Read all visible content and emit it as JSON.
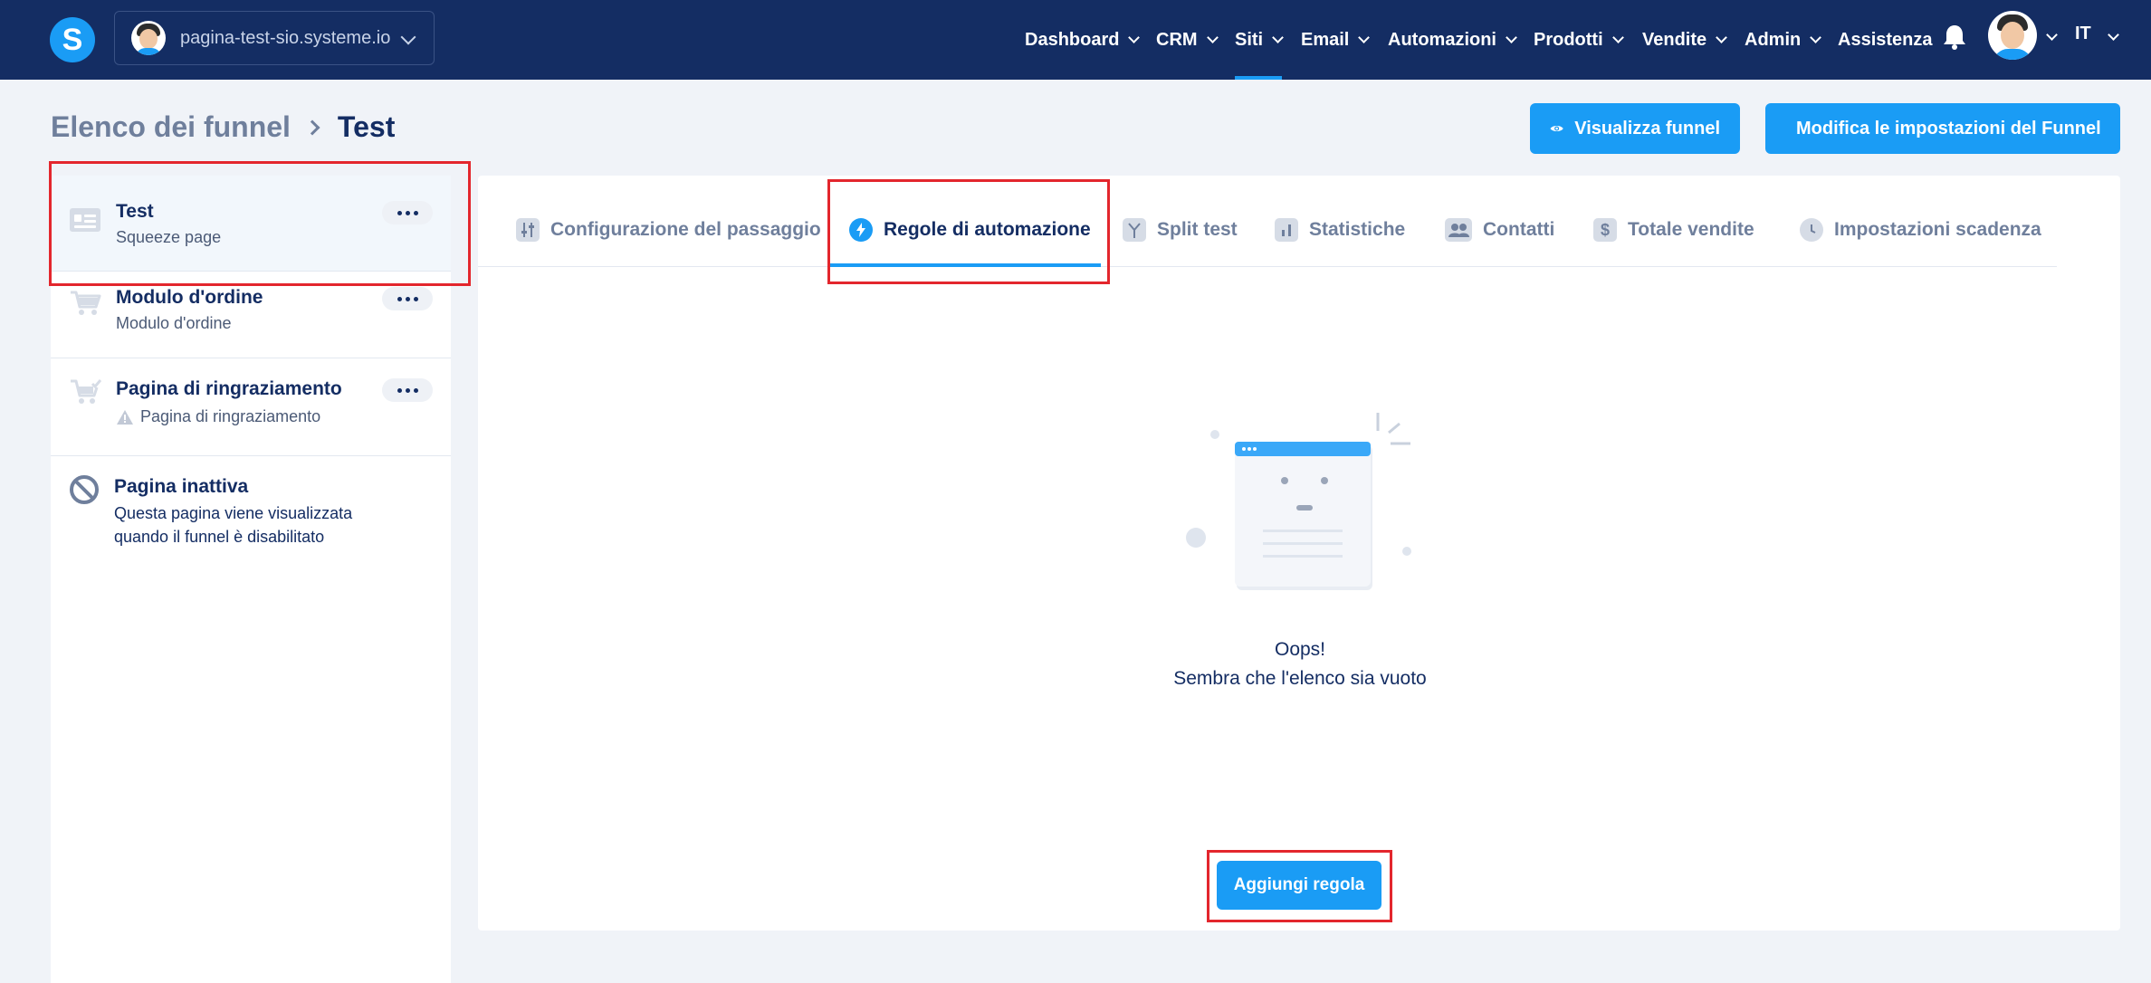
{
  "topbar": {
    "site_name": "pagina-test-sio.systeme.io",
    "nav": [
      "Dashboard",
      "CRM",
      "Siti",
      "Email",
      "Automazioni",
      "Prodotti",
      "Vendite",
      "Admin",
      "Assistenza"
    ],
    "active_nav": "Siti",
    "language": "IT"
  },
  "header": {
    "breadcrumb_parent": "Elenco dei funnel",
    "breadcrumb_current": "Test",
    "view_funnel_label": "Visualizza funnel",
    "settings_label": "Modifica le impostazioni del Funnel"
  },
  "steps": [
    {
      "title": "Test",
      "subtitle": "Squeeze page"
    },
    {
      "title": "Modulo d'ordine",
      "subtitle": "Modulo d'ordine"
    },
    {
      "title": "Pagina di ringraziamento",
      "subtitle": "Pagina di ringraziamento"
    },
    {
      "title": "Pagina inattiva",
      "subtitle_line1": "Questa pagina viene visualizzata",
      "subtitle_line2": "quando il funnel è disabilitato"
    }
  ],
  "tabs": [
    "Configurazione del passaggio",
    "Regole di automazione",
    "Split test",
    "Statistiche",
    "Contatti",
    "Totale vendite",
    "Impostazioni scadenza"
  ],
  "active_tab": "Regole di automazione",
  "empty_state": {
    "title": "Oops!",
    "subtitle": "Sembra che l'elenco sia vuoto"
  },
  "add_rule_label": "Aggiungi regola",
  "colors": {
    "navbar": "#142d63",
    "accent": "#1a9cf5",
    "highlight_box": "#e3262d",
    "background": "#f0f3f8"
  }
}
